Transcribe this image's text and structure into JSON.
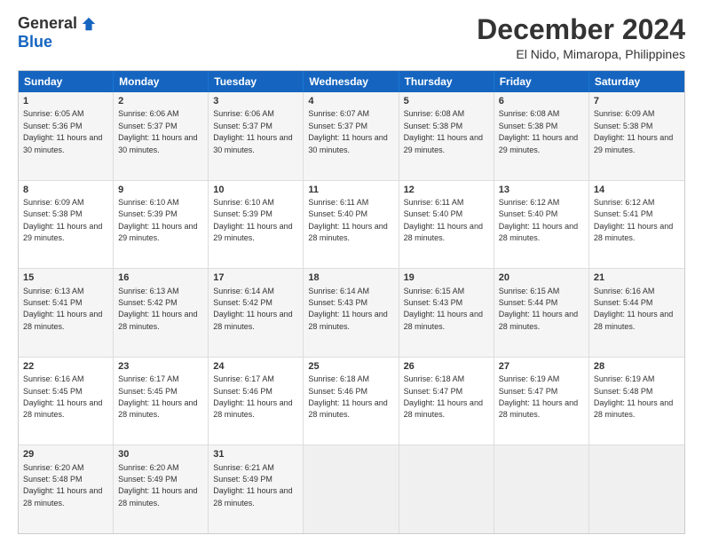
{
  "logo": {
    "general": "General",
    "blue": "Blue"
  },
  "title": "December 2024",
  "location": "El Nido, Mimaropa, Philippines",
  "days": [
    "Sunday",
    "Monday",
    "Tuesday",
    "Wednesday",
    "Thursday",
    "Friday",
    "Saturday"
  ],
  "weeks": [
    [
      {
        "day": "1",
        "sunrise": "6:05 AM",
        "sunset": "5:36 PM",
        "daylight": "11 hours and 30 minutes."
      },
      {
        "day": "2",
        "sunrise": "6:06 AM",
        "sunset": "5:37 PM",
        "daylight": "11 hours and 30 minutes."
      },
      {
        "day": "3",
        "sunrise": "6:06 AM",
        "sunset": "5:37 PM",
        "daylight": "11 hours and 30 minutes."
      },
      {
        "day": "4",
        "sunrise": "6:07 AM",
        "sunset": "5:37 PM",
        "daylight": "11 hours and 30 minutes."
      },
      {
        "day": "5",
        "sunrise": "6:08 AM",
        "sunset": "5:38 PM",
        "daylight": "11 hours and 29 minutes."
      },
      {
        "day": "6",
        "sunrise": "6:08 AM",
        "sunset": "5:38 PM",
        "daylight": "11 hours and 29 minutes."
      },
      {
        "day": "7",
        "sunrise": "6:09 AM",
        "sunset": "5:38 PM",
        "daylight": "11 hours and 29 minutes."
      }
    ],
    [
      {
        "day": "8",
        "sunrise": "6:09 AM",
        "sunset": "5:38 PM",
        "daylight": "11 hours and 29 minutes."
      },
      {
        "day": "9",
        "sunrise": "6:10 AM",
        "sunset": "5:39 PM",
        "daylight": "11 hours and 29 minutes."
      },
      {
        "day": "10",
        "sunrise": "6:10 AM",
        "sunset": "5:39 PM",
        "daylight": "11 hours and 29 minutes."
      },
      {
        "day": "11",
        "sunrise": "6:11 AM",
        "sunset": "5:40 PM",
        "daylight": "11 hours and 28 minutes."
      },
      {
        "day": "12",
        "sunrise": "6:11 AM",
        "sunset": "5:40 PM",
        "daylight": "11 hours and 28 minutes."
      },
      {
        "day": "13",
        "sunrise": "6:12 AM",
        "sunset": "5:40 PM",
        "daylight": "11 hours and 28 minutes."
      },
      {
        "day": "14",
        "sunrise": "6:12 AM",
        "sunset": "5:41 PM",
        "daylight": "11 hours and 28 minutes."
      }
    ],
    [
      {
        "day": "15",
        "sunrise": "6:13 AM",
        "sunset": "5:41 PM",
        "daylight": "11 hours and 28 minutes."
      },
      {
        "day": "16",
        "sunrise": "6:13 AM",
        "sunset": "5:42 PM",
        "daylight": "11 hours and 28 minutes."
      },
      {
        "day": "17",
        "sunrise": "6:14 AM",
        "sunset": "5:42 PM",
        "daylight": "11 hours and 28 minutes."
      },
      {
        "day": "18",
        "sunrise": "6:14 AM",
        "sunset": "5:43 PM",
        "daylight": "11 hours and 28 minutes."
      },
      {
        "day": "19",
        "sunrise": "6:15 AM",
        "sunset": "5:43 PM",
        "daylight": "11 hours and 28 minutes."
      },
      {
        "day": "20",
        "sunrise": "6:15 AM",
        "sunset": "5:44 PM",
        "daylight": "11 hours and 28 minutes."
      },
      {
        "day": "21",
        "sunrise": "6:16 AM",
        "sunset": "5:44 PM",
        "daylight": "11 hours and 28 minutes."
      }
    ],
    [
      {
        "day": "22",
        "sunrise": "6:16 AM",
        "sunset": "5:45 PM",
        "daylight": "11 hours and 28 minutes."
      },
      {
        "day": "23",
        "sunrise": "6:17 AM",
        "sunset": "5:45 PM",
        "daylight": "11 hours and 28 minutes."
      },
      {
        "day": "24",
        "sunrise": "6:17 AM",
        "sunset": "5:46 PM",
        "daylight": "11 hours and 28 minutes."
      },
      {
        "day": "25",
        "sunrise": "6:18 AM",
        "sunset": "5:46 PM",
        "daylight": "11 hours and 28 minutes."
      },
      {
        "day": "26",
        "sunrise": "6:18 AM",
        "sunset": "5:47 PM",
        "daylight": "11 hours and 28 minutes."
      },
      {
        "day": "27",
        "sunrise": "6:19 AM",
        "sunset": "5:47 PM",
        "daylight": "11 hours and 28 minutes."
      },
      {
        "day": "28",
        "sunrise": "6:19 AM",
        "sunset": "5:48 PM",
        "daylight": "11 hours and 28 minutes."
      }
    ],
    [
      {
        "day": "29",
        "sunrise": "6:20 AM",
        "sunset": "5:48 PM",
        "daylight": "11 hours and 28 minutes."
      },
      {
        "day": "30",
        "sunrise": "6:20 AM",
        "sunset": "5:49 PM",
        "daylight": "11 hours and 28 minutes."
      },
      {
        "day": "31",
        "sunrise": "6:21 AM",
        "sunset": "5:49 PM",
        "daylight": "11 hours and 28 minutes."
      },
      null,
      null,
      null,
      null
    ]
  ]
}
